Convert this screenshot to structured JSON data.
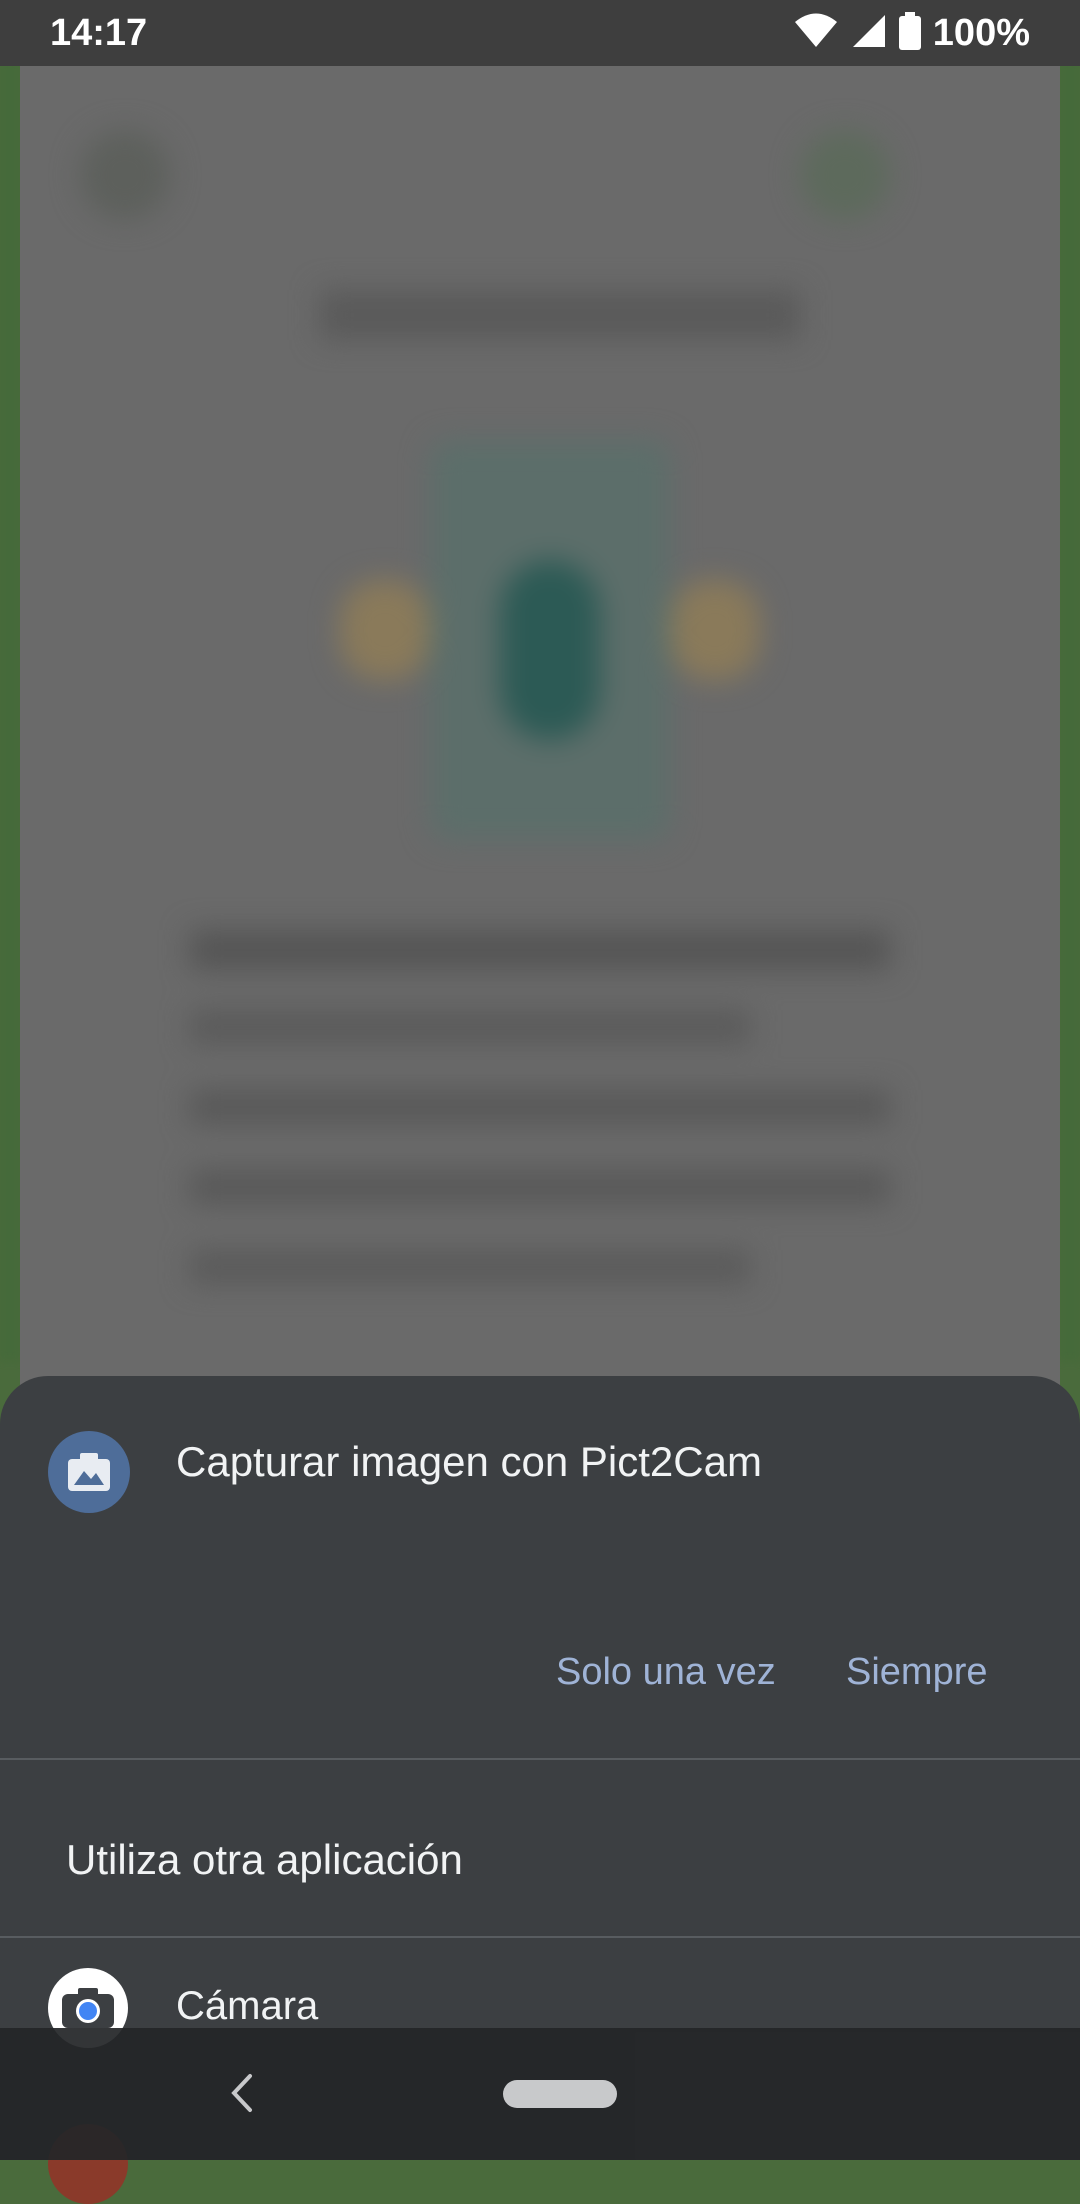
{
  "status_bar": {
    "time": "14:17",
    "battery": "100%",
    "icons": [
      "wifi-icon",
      "signal-icon",
      "battery-icon"
    ]
  },
  "chooser": {
    "app_icon": "pict2cam-icon",
    "title": "Capturar imagen con Pict2Cam",
    "just_once_label": "Solo una vez",
    "always_label": "Siempre",
    "other_app_heading": "Utiliza otra aplicación",
    "apps": [
      {
        "icon": "camera-app-icon",
        "label": "Cámara"
      }
    ]
  },
  "nav_bar": {
    "icons": [
      "back-icon",
      "home-pill"
    ]
  },
  "colors": {
    "sheet_bg": "#3c3f42",
    "accent_text": "#9fb3d6",
    "status_bar_bg": "#3e3e3e"
  }
}
